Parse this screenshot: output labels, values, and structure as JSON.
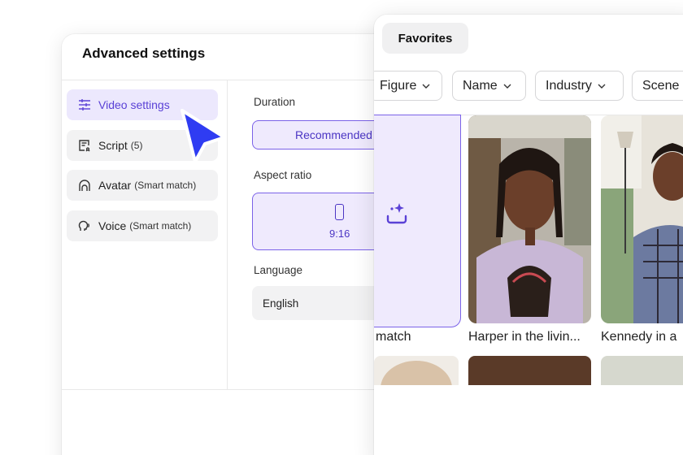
{
  "settings": {
    "title": "Advanced settings",
    "nav": [
      {
        "label": "Video settings",
        "sub": "",
        "icon": "sliders-icon",
        "active": true
      },
      {
        "label": "Script",
        "sub": "(5)",
        "icon": "script-icon",
        "active": false
      },
      {
        "label": "Avatar",
        "sub": "(Smart match)",
        "icon": "avatar-icon",
        "active": false
      },
      {
        "label": "Voice",
        "sub": "(Smart match)",
        "icon": "voice-icon",
        "active": false
      }
    ],
    "duration_label": "Duration",
    "duration_value": "Recommended",
    "aspect_label": "Aspect ratio",
    "aspect_value": "9:16",
    "language_label": "Language",
    "language_value": "English"
  },
  "avatars": {
    "tab": "Favorites",
    "filters": [
      "Figure",
      "Name",
      "Industry",
      "Scene"
    ],
    "smart_caption": "match",
    "cards": [
      {
        "caption": "Harper in the livin..."
      },
      {
        "caption": "Kennedy in a"
      }
    ]
  },
  "colors": {
    "accent": "#5a41d6",
    "accent_bg": "#efeafd",
    "cursor": "#2f3cf2"
  }
}
